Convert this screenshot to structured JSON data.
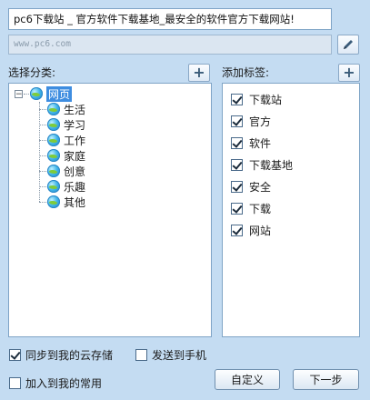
{
  "title_input": {
    "value": "pc6下载站 _ 官方软件下载基地_最安全的软件官方下载网站!"
  },
  "url_input": {
    "value": "www.pc6.com"
  },
  "icons": {
    "edit": "pencil-icon",
    "add": "plus-icon",
    "node": "globe-icon"
  },
  "category": {
    "label": "选择分类:",
    "root": {
      "label": "网页",
      "expanded": true,
      "selected": true
    },
    "children": [
      "生活",
      "学习",
      "工作",
      "家庭",
      "创意",
      "乐趣",
      "其他"
    ]
  },
  "tags": {
    "label": "添加标签:",
    "items": [
      {
        "label": "下载站",
        "checked": true
      },
      {
        "label": "官方",
        "checked": true
      },
      {
        "label": "软件",
        "checked": true
      },
      {
        "label": "下载基地",
        "checked": true
      },
      {
        "label": "安全",
        "checked": true
      },
      {
        "label": "下载",
        "checked": true
      },
      {
        "label": "网站",
        "checked": true
      }
    ]
  },
  "options": {
    "sync_cloud": {
      "label": "同步到我的云存储",
      "checked": true
    },
    "send_phone": {
      "label": "发送到手机",
      "checked": false
    },
    "add_favorites": {
      "label": "加入到我的常用",
      "checked": false
    }
  },
  "buttons": {
    "custom": "自定义",
    "next": "下一步"
  },
  "colors": {
    "background": "#c4dcf2",
    "selection": "#3e8de0",
    "border": "#7fa4c6"
  }
}
